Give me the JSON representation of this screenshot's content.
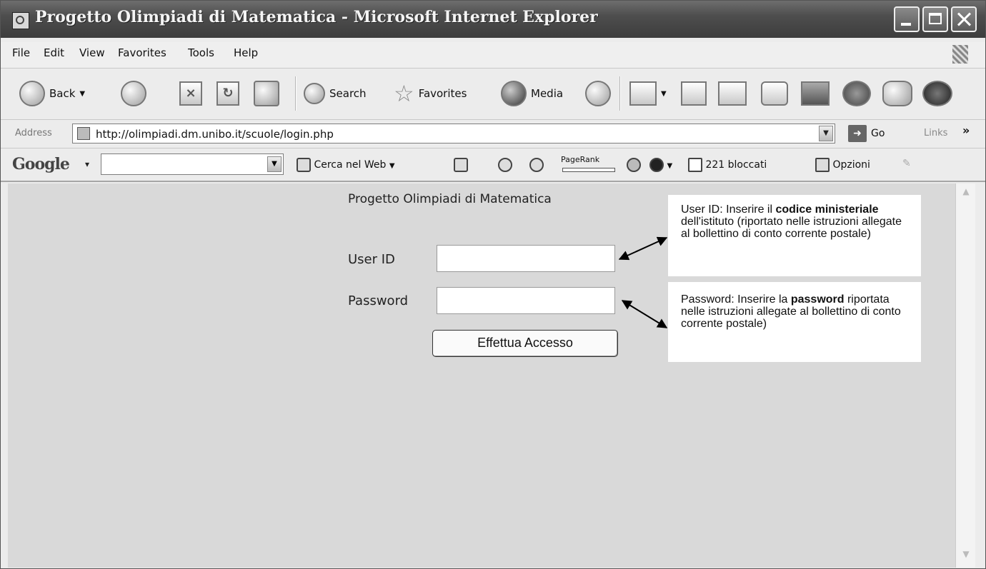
{
  "window": {
    "title": "Progetto Olimpiadi di Matematica - Microsoft Internet Explorer"
  },
  "menu": [
    "File",
    "Edit",
    "View",
    "Favorites",
    "Tools",
    "Help"
  ],
  "toolbar": {
    "back_label": "Back",
    "search_label": "Search",
    "favorites_label": "Favorites",
    "media_label": "Media"
  },
  "address": {
    "label": "Address",
    "url": "http://olimpiadi.dm.unibo.it/scuole/login.php",
    "go_label": "Go",
    "links_label": "Links",
    "links_chevron": "»"
  },
  "google_toolbar": {
    "logo": "Google",
    "search_web_label": "Cerca nel Web",
    "pagerank_label": "PageRank",
    "blocked_label": "221 bloccati",
    "options_label": "Opzioni"
  },
  "page": {
    "heading": "Progetto Olimpiadi di Matematica",
    "userid_label": "User ID",
    "password_label": "Password",
    "login_button": "Effettua Accesso",
    "userid_note": {
      "before": "User ID: Inserire il ",
      "bold": "codice ministeriale",
      "after": " dell'istituto (riportato nelle istruzioni allegate al bollettino di conto corrente postale)"
    },
    "password_note": {
      "before": "Password: Inserire la ",
      "bold": "password",
      "after": " riportata nelle istruzioni allegate al bollettino di conto corrente postale)"
    }
  },
  "icons": {
    "back": "back-arrow-icon",
    "forward": "forward-arrow-icon",
    "stop": "stop-icon",
    "refresh": "refresh-icon",
    "home": "home-icon",
    "search": "search-icon",
    "favorites": "star-icon",
    "media": "media-icon",
    "history": "history-icon",
    "mail": "mail-icon",
    "print": "print-icon"
  }
}
